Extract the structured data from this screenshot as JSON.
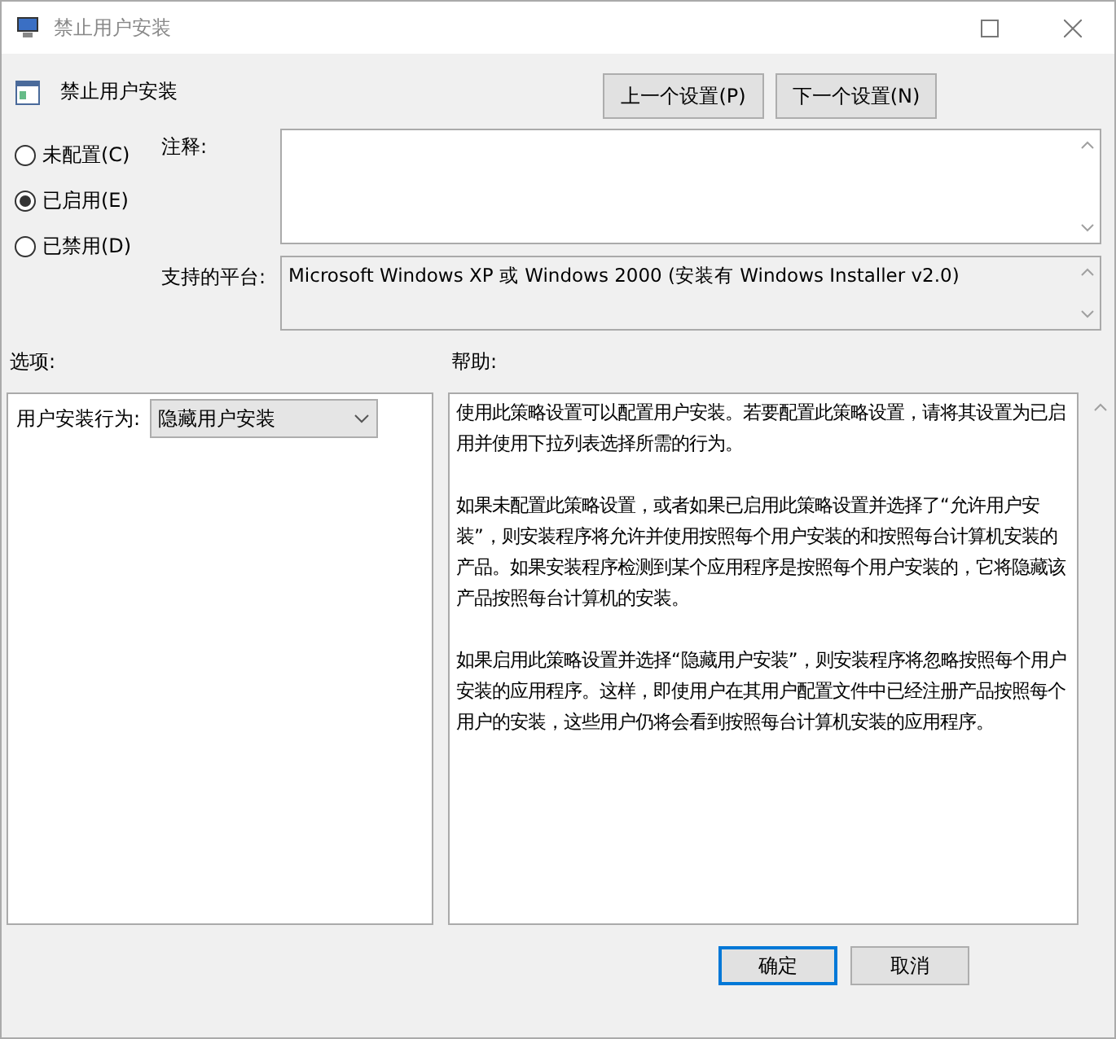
{
  "window": {
    "title": "禁止用户安装"
  },
  "policy_title": "禁止用户安装",
  "nav_buttons": [
    "上一个设置(P)",
    "下一个设置(N)"
  ],
  "states": [
    {
      "label": "未配置(C)",
      "selected": false
    },
    {
      "label": "已启用(E)",
      "selected": true
    },
    {
      "label": "已禁用(D)",
      "selected": false
    }
  ],
  "comment": {
    "label": "注释:"
  },
  "platform": {
    "label": "支持的平台:",
    "value": "Microsoft Windows XP 或 Windows 2000 (安装有 Windows Installer v2.0)"
  },
  "options": {
    "label": "选项:",
    "field_label": "用户安装行为:",
    "dropdown_value": "隐藏用户安装"
  },
  "help": {
    "label": "帮助:",
    "paragraphs": [
      "使用此策略设置可以配置用户安装。若要配置此策略设置，请将其设置为已启用并使用下拉列表选择所需的行为。",
      "如果未配置此策略设置，或者如果已启用此策略设置并选择了“允许用户安装”，则安装程序将允许并使用按照每个用户安装的和按照每台计算机安装的产品。如果安装程序检测到某个应用程序是按照每个用户安装的，它将隐藏该产品按照每台计算机的安装。",
      "如果启用此策略设置并选择“隐藏用户安装”，则安装程序将忽略按照每个用户安装的应用程序。这样，即使用户在其用户配置文件中已经注册产品按照每个用户的安装，这些用户仍将会看到按照每台计算机安装的应用程序。"
    ]
  },
  "buttons": [
    {
      "label": "确定",
      "kind": "default"
    },
    {
      "label": "取消",
      "kind": "normal"
    }
  ]
}
